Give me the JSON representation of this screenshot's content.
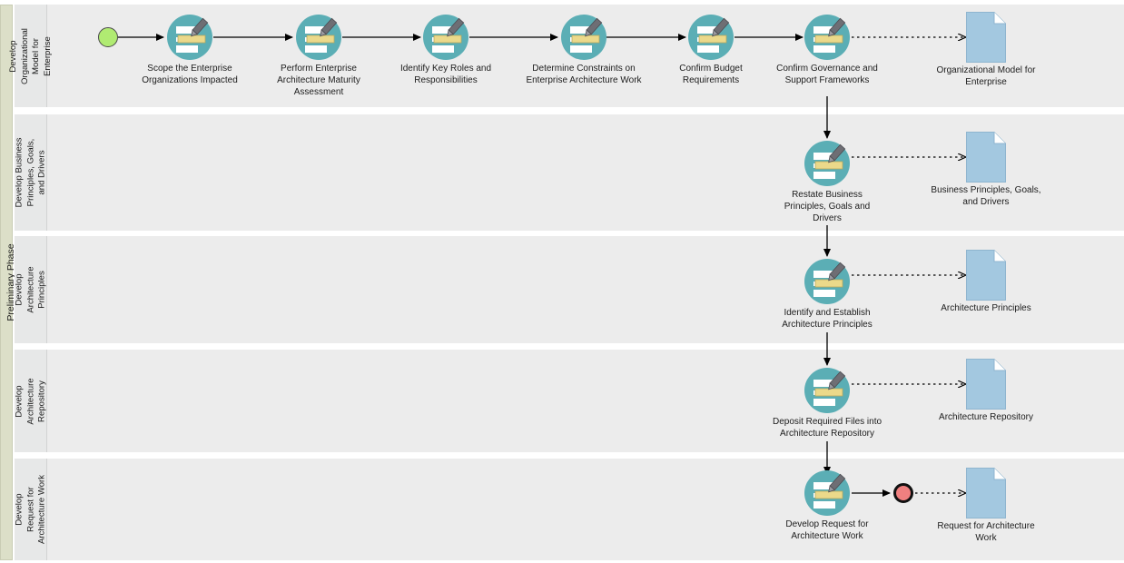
{
  "pool": {
    "label": "Preliminary Phase",
    "header_color": "#DCDFC8",
    "lane_color": "#ECECEC"
  },
  "colors": {
    "task_icon": "#5BAEB5",
    "task_highlight": "#EBD98A",
    "data_object": "#A3C8E0",
    "start_event": "#B0EB72",
    "end_event": "#F08080",
    "flow_line": "#000000"
  },
  "lanes": [
    {
      "id": "lane-develop-organizational-model",
      "label": "Develop\nOrganizational\nModel for\nEnterprise",
      "label_lines": [
        "Develop",
        "Organizational",
        "Model for",
        "Enterprise"
      ]
    },
    {
      "id": "lane-develop-business-principles",
      "label": "Develop Business\nPrinciples, Goals,\nand Drivers",
      "label_lines": [
        "Develop Business",
        "Principles, Goals,",
        "and Drivers"
      ]
    },
    {
      "id": "lane-develop-architecture-principles",
      "label": "Develop\nArchitecture\nPrinciples",
      "label_lines": [
        "Develop",
        "Architecture",
        "Principles"
      ]
    },
    {
      "id": "lane-develop-architecture-repository",
      "label": "Develop\nArchitecture\nRepository",
      "label_lines": [
        "Develop",
        "Architecture",
        "Repository"
      ]
    },
    {
      "id": "lane-develop-request-for-architecture-work",
      "label": "Develop\nRequest for\nArchitecture Work",
      "label_lines": [
        "Develop",
        "Request for",
        "Architecture Work"
      ]
    }
  ],
  "events": {
    "start": {
      "name": "start-event",
      "type": "start"
    },
    "end": {
      "name": "end-event",
      "type": "end"
    }
  },
  "tasks": [
    {
      "id": "task-scope-enterprise",
      "label": "Scope the Enterprise\nOrganizations Impacted"
    },
    {
      "id": "task-perform-maturity",
      "label": "Perform Enterprise\nArchitecture Maturity\nAssessment"
    },
    {
      "id": "task-identify-roles",
      "label": "Identify Key Roles and\nResponsibilities"
    },
    {
      "id": "task-determine-constraints",
      "label": "Determine Constraints on\nEnterprise Architecture Work"
    },
    {
      "id": "task-confirm-budget",
      "label": "Confirm Budget\nRequirements"
    },
    {
      "id": "task-confirm-governance",
      "label": "Confirm Governance and\nSupport Frameworks"
    },
    {
      "id": "task-restate-business",
      "label": "Restate Business\nPrinciples, Goals and\nDrivers"
    },
    {
      "id": "task-identify-establish",
      "label": "Identify and Establish\nArchitecture Principles"
    },
    {
      "id": "task-deposit-files",
      "label": "Deposit Required Files into\nArchitecture Repository"
    },
    {
      "id": "task-develop-request",
      "label": "Develop Request for\nArchitecture Work"
    }
  ],
  "data_objects": [
    {
      "id": "data-organizational-model",
      "label": "Organizational Model for\nEnterprise"
    },
    {
      "id": "data-business-principles",
      "label": "Business Principles, Goals,\nand Drivers"
    },
    {
      "id": "data-architecture-principles",
      "label": "Architecture Principles"
    },
    {
      "id": "data-architecture-repository",
      "label": "Architecture Repository"
    },
    {
      "id": "data-request-architecture",
      "label": "Request for Architecture\nWork"
    }
  ]
}
